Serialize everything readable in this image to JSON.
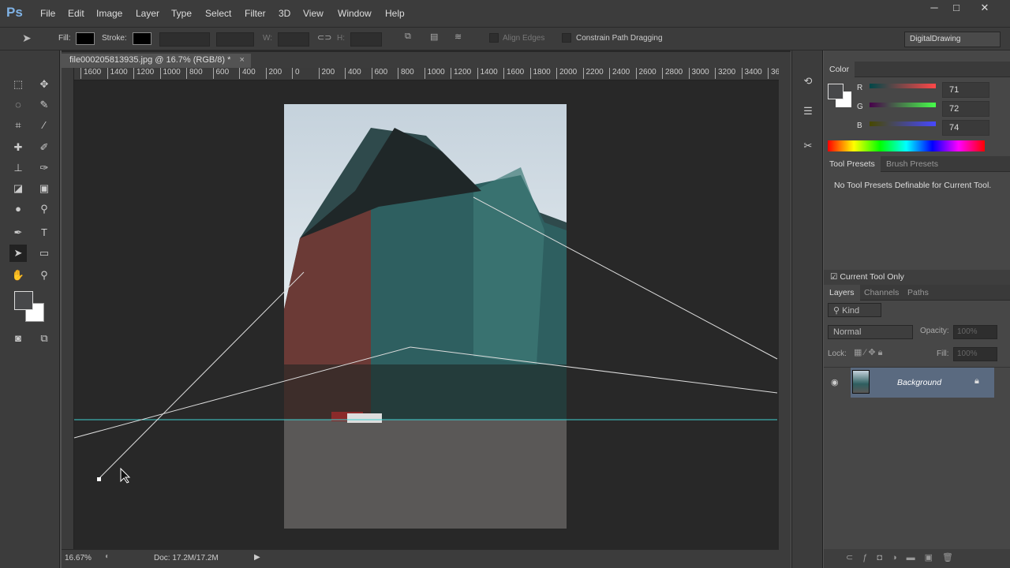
{
  "app": {
    "logo": "Ps",
    "menu": [
      "File",
      "Edit",
      "Image",
      "Layer",
      "Type",
      "Select",
      "Filter",
      "3D",
      "View",
      "Window",
      "Help"
    ],
    "window_buttons": [
      "─",
      "□",
      "✕"
    ]
  },
  "options": {
    "fill_label": "Fill:",
    "stroke_label": "Stroke:",
    "w_label": "W:",
    "h_label": "H:",
    "align_edges": "Align Edges",
    "constrain": "Constrain Path Dragging",
    "workspace": "DigitalDrawing"
  },
  "document": {
    "tab_title": "file000205813935.jpg @ 16.7% (RGB/8) *",
    "close": "×",
    "zoom": "16.67%",
    "doc_size": "Doc: 17.2M/17.2M",
    "ruler_h": [
      "1600",
      "1400",
      "1200",
      "1000",
      "800",
      "600",
      "400",
      "200",
      "0",
      "200",
      "400",
      "600",
      "800",
      "1000",
      "1200",
      "1400",
      "1600",
      "1800",
      "2000",
      "2200",
      "2400",
      "2600",
      "2800",
      "3000",
      "3200",
      "3400",
      "36"
    ]
  },
  "color_panel": {
    "title": "Color",
    "r_label": "R",
    "g_label": "G",
    "b_label": "B",
    "r": "71",
    "g": "72",
    "b": "74",
    "foreground": "#47484a",
    "background": "#ffffff"
  },
  "tool_presets": {
    "tabs": [
      "Tool Presets",
      "Brush Presets"
    ],
    "message": "No Tool Presets Definable for Current Tool.",
    "current_tool_only": "Current Tool Only"
  },
  "layers": {
    "tabs": [
      "Layers",
      "Channels",
      "Paths"
    ],
    "kind": "Kind",
    "blend": "Normal",
    "opacity_label": "Opacity:",
    "opacity": "100%",
    "lock_label": "Lock:",
    "fill_label": "Fill:",
    "fill": "100%",
    "items": [
      {
        "name": "Background",
        "locked": true,
        "visible": true
      }
    ]
  },
  "guide_color": "#3fd0d0"
}
